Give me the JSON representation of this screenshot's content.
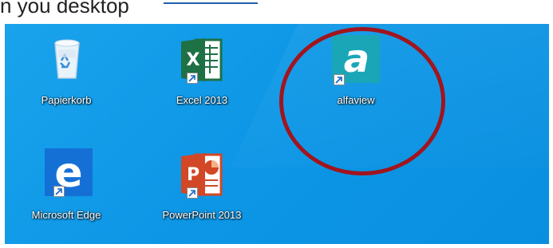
{
  "header": {
    "text": "n you                    desktop"
  },
  "desktop": {
    "icons": [
      {
        "label": "Papierkorb",
        "icon": "recycle-bin-icon"
      },
      {
        "label": "Excel 2013",
        "icon": "excel-icon",
        "glyph": "X"
      },
      {
        "label": "alfaview",
        "icon": "alfaview-icon",
        "glyph": "a"
      },
      {
        "label": "Microsoft Edge",
        "icon": "edge-icon",
        "glyph": "e"
      },
      {
        "label": "PowerPoint 2013",
        "icon": "powerpoint-icon",
        "glyph": "P"
      }
    ]
  },
  "colors": {
    "desktop_bg": "#0d97e6",
    "excel": "#1e7145",
    "powerpoint": "#d24726",
    "edge": "#1570d6",
    "alfaview": "#1aa6b7",
    "highlight_circle": "#a0151e"
  }
}
